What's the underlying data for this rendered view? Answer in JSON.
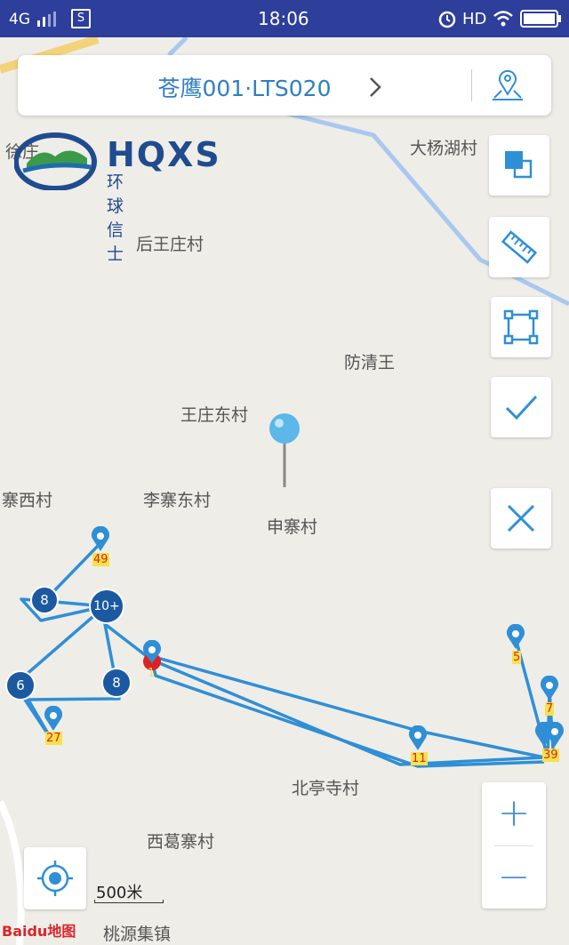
{
  "status_bar": {
    "network": "4G",
    "sim_badge": "S",
    "time": "18:06",
    "hd": "HD"
  },
  "header": {
    "title": "苍鹰001·LTS020",
    "chevron": "›",
    "location_icon": "map-pin-icon"
  },
  "logo": {
    "brand": "HQXS",
    "subtitle": "环球信士"
  },
  "tools": [
    {
      "name": "layers-icon"
    },
    {
      "name": "ruler-icon"
    },
    {
      "name": "select-area-icon"
    },
    {
      "name": "check-icon"
    },
    {
      "name": "close-icon"
    }
  ],
  "places": {
    "xuzhuang": "徐庄",
    "dayanghu": "大杨湖村",
    "houwangzhuang": "后王庄村",
    "fangqingwang": "防清王",
    "wangzhuangdong": "王庄东村",
    "zhaixi": "寨西村",
    "lizhaidong": "李寨东村",
    "shenzhai": "申寨村",
    "beitingsi": "北亭寺村",
    "xigezhai": "西葛寨村",
    "taoyuan": "桃源集镇"
  },
  "clusters": {
    "c1": "8",
    "c2": "10+",
    "c3": "6",
    "c4": "8"
  },
  "markers": {
    "m49": "49",
    "m27": "27",
    "m1": "1",
    "m11": "11",
    "m5": "5",
    "m7": "7",
    "m39": "39"
  },
  "zoom": {
    "in": "+",
    "out": "−"
  },
  "scale": "500米",
  "attribution": "Baidu地图",
  "accent_color": "#2f8fd6"
}
